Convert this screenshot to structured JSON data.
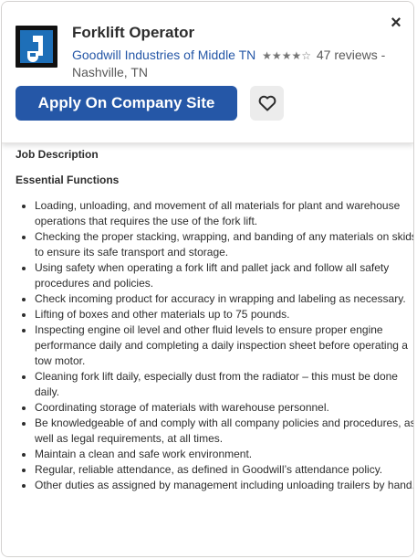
{
  "header": {
    "job_title": "Forklift Operator",
    "company_name": "Goodwill Industries of Middle TN",
    "rating_stars": "★★★★☆",
    "reviews": "47 reviews",
    "separator": "-",
    "location": "Nashville, TN",
    "apply_label": "Apply On Company Site",
    "save_icon": "heart-outline-icon",
    "close_icon": "close-icon",
    "close_glyph": "×"
  },
  "body": {
    "section_title": "Job Description",
    "subsection_title": "Essential Functions",
    "duties": [
      "Loading, unloading, and movement of all materials for plant and warehouse operations that requires the use of the fork lift.",
      "Checking the proper stacking, wrapping, and banding of any materials on skids to ensure its safe transport and storage.",
      "Using safety when operating a fork lift and pallet jack and follow all safety procedures and policies.",
      "Check incoming product for accuracy in wrapping and labeling as necessary.",
      "Lifting of boxes and other materials up to 75 pounds.",
      "Inspecting engine oil level and other fluid levels to ensure proper engine performance daily and completing a daily inspection sheet before operating a tow motor.",
      "Cleaning fork lift daily, especially dust from the radiator – this must be done daily.",
      "Coordinating storage of materials with warehouse personnel.",
      "Be knowledgeable of and comply with all company policies and procedures, as well as legal requirements, at all times.",
      "Maintain a clean and safe work environment.",
      "Regular, reliable attendance, as defined in Goodwill’s attendance policy.",
      "Other duties as assigned by management including unloading trailers by hand."
    ]
  },
  "colors": {
    "brand_blue": "#2557a7",
    "logo_blue": "#1e6fb8",
    "text": "#2d2d2d"
  }
}
